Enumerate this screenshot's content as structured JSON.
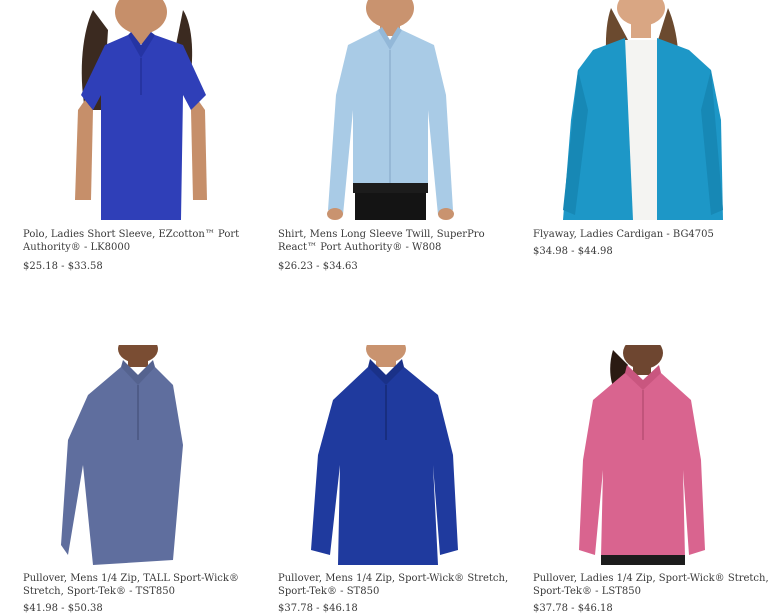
{
  "products": [
    {
      "name": "Polo, Ladies Short Sleeve, EZcotton™ Port Authority® - LK8000",
      "price": "$25.18 - $33.58",
      "image_icon": "ladies-polo-image",
      "color": "#2f3fb8"
    },
    {
      "name": "Shirt, Mens Long Sleeve Twill, SuperPro React™ Port Authority® - W808",
      "price": "$26.23 - $34.63",
      "image_icon": "mens-shirt-image",
      "color": "#a9cbe6"
    },
    {
      "name": "Flyaway, Ladies Cardigan - BG4705",
      "price": "$34.98 - $44.98",
      "image_icon": "ladies-cardigan-image",
      "color": "#1d97c7"
    },
    {
      "name": "Pullover, Mens 1/4 Zip, TALL Sport-Wick® Stretch, Sport-Tek® - TST850",
      "price": "$41.98 - $50.38",
      "image_icon": "mens-pullover-tall-image",
      "color": "#5f6e9e"
    },
    {
      "name": "Pullover, Mens 1/4 Zip, Sport-Wick® Stretch, Sport-Tek® - ST850",
      "price": "$37.78 - $46.18",
      "image_icon": "mens-pullover-image",
      "color": "#1f3a9e"
    },
    {
      "name": "Pullover, Ladies 1/4 Zip, Sport-Wick® Stretch, Sport-Tek® - LST850",
      "price": "$37.78 - $46.18",
      "image_icon": "ladies-pullover-image",
      "color": "#d9648f"
    }
  ]
}
